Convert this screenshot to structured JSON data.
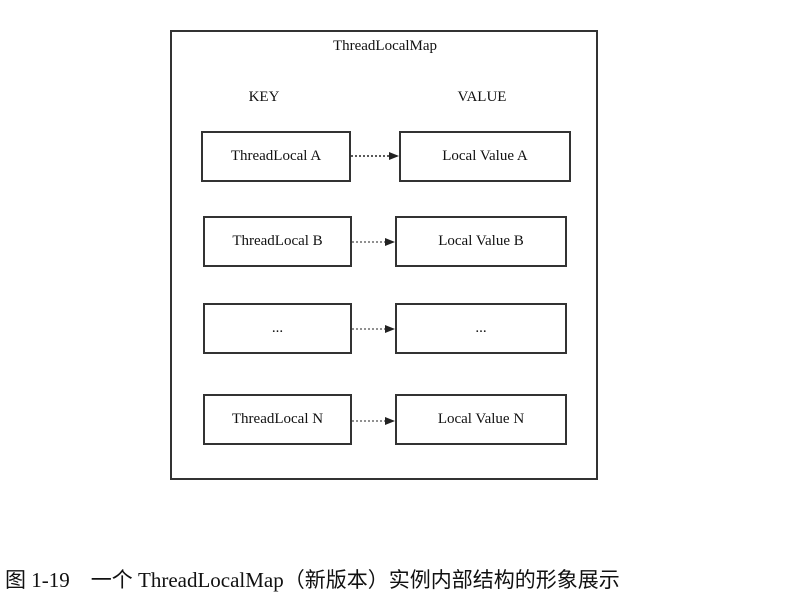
{
  "diagram": {
    "title": "ThreadLocalMap",
    "key_header": "KEY",
    "value_header": "VALUE",
    "rows": [
      {
        "key": "ThreadLocal A",
        "value": "Local Value A"
      },
      {
        "key": "ThreadLocal B",
        "value": "Local Value B"
      },
      {
        "key": "...",
        "value": "..."
      },
      {
        "key": "ThreadLocal N",
        "value": "Local Value N"
      }
    ],
    "edge_style": "dashed-arrow"
  },
  "caption": "图 1-19　一个 ThreadLocalMap（新版本）实例内部结构的形象展示"
}
